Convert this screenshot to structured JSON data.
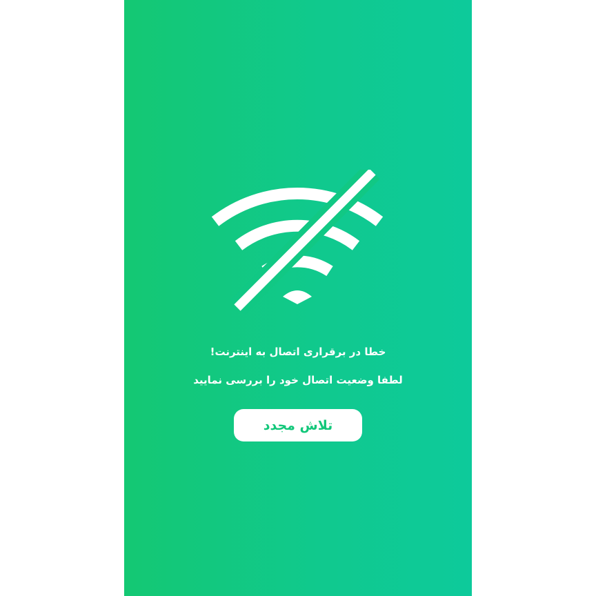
{
  "error_screen": {
    "icon": "wifi-off-icon",
    "message_line_1": "خطا در برقراری اتصال به اینترنت!",
    "message_line_2": "لطفا وضعیت اتصال خود را بررسی نمایید",
    "retry_label": "تلاش مجدد"
  },
  "colors": {
    "background_start": "#14c873",
    "background_end": "#0dca9b",
    "foreground": "#ffffff",
    "button_text": "#12c77a"
  }
}
